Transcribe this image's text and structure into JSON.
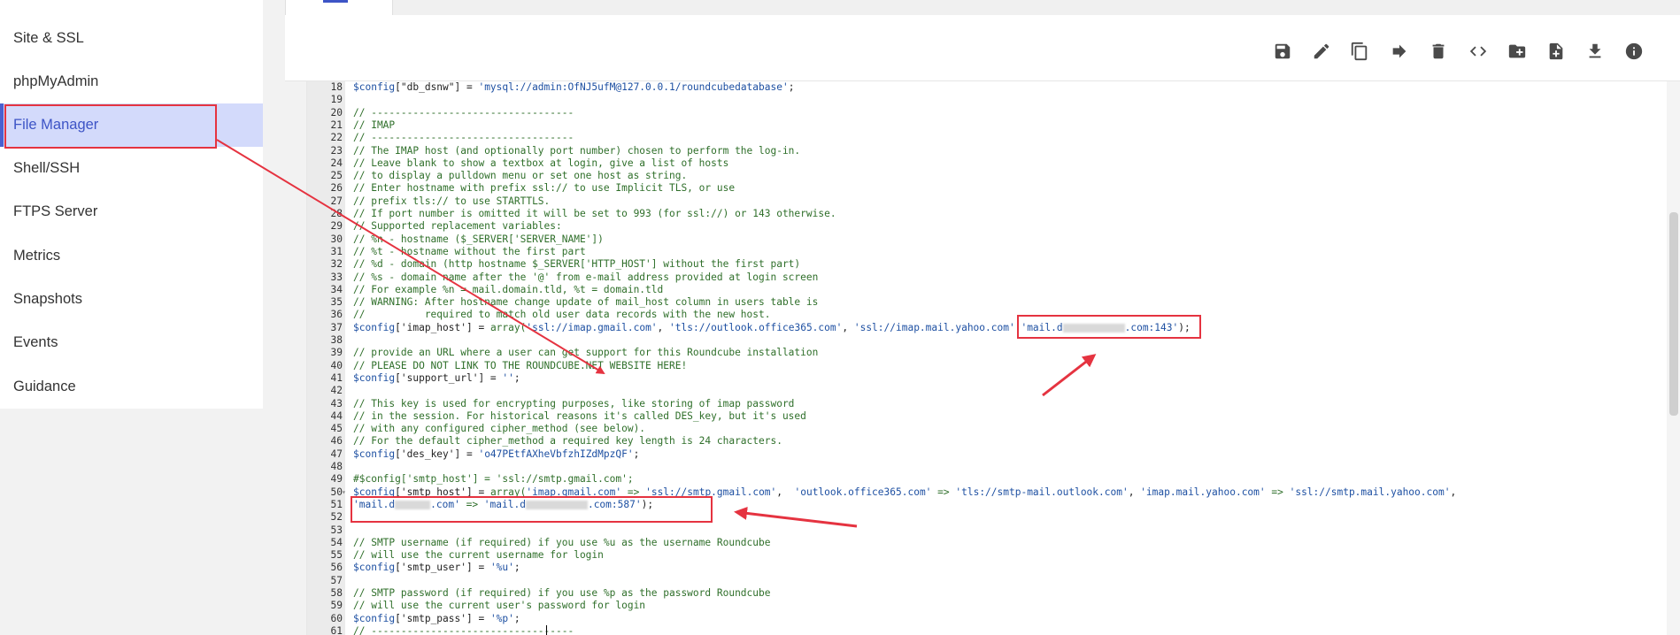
{
  "sidebar": {
    "items": [
      {
        "label": "Site & SSL",
        "active": false
      },
      {
        "label": "phpMyAdmin",
        "active": false
      },
      {
        "label": "File Manager",
        "active": true
      },
      {
        "label": "Shell/SSH",
        "active": false
      },
      {
        "label": "FTPS Server",
        "active": false
      },
      {
        "label": "Metrics",
        "active": false
      },
      {
        "label": "Snapshots",
        "active": false
      },
      {
        "label": "Events",
        "active": false
      },
      {
        "label": "Guidance",
        "active": false
      }
    ]
  },
  "toolbar": {
    "icons": [
      "save-icon",
      "edit-icon",
      "copy-icon",
      "move-icon",
      "delete-icon",
      "code-icon",
      "new-folder-icon",
      "new-file-icon",
      "download-icon",
      "info-icon"
    ]
  },
  "editor": {
    "lines": [
      {
        "n": "18",
        "segs": [
          [
            "var",
            "$config"
          ],
          [
            "",
            "[\"db_dsnw\"] = "
          ],
          [
            "str",
            "'mysql://admin:OfNJ5ufM@127.0.0.1/roundcubedatabase'"
          ],
          [
            "",
            ";"
          ]
        ]
      },
      {
        "n": "19",
        "segs": []
      },
      {
        "n": "20",
        "segs": [
          [
            "cmt",
            "// ----------------------------------"
          ]
        ]
      },
      {
        "n": "21",
        "segs": [
          [
            "cmt",
            "// IMAP"
          ]
        ]
      },
      {
        "n": "22",
        "segs": [
          [
            "cmt",
            "// ----------------------------------"
          ]
        ]
      },
      {
        "n": "23",
        "segs": [
          [
            "cmt",
            "// The IMAP host (and optionally port number) chosen to perform the log-in."
          ]
        ]
      },
      {
        "n": "24",
        "segs": [
          [
            "cmt",
            "// Leave blank to show a textbox at login, give a list of hosts"
          ]
        ]
      },
      {
        "n": "25",
        "segs": [
          [
            "cmt",
            "// to display a pulldown menu or set one host as string."
          ]
        ]
      },
      {
        "n": "26",
        "segs": [
          [
            "cmt",
            "// Enter hostname with prefix ssl:// to use Implicit TLS, or use"
          ]
        ]
      },
      {
        "n": "27",
        "segs": [
          [
            "cmt",
            "// prefix tls:// to use STARTTLS."
          ]
        ]
      },
      {
        "n": "28",
        "segs": [
          [
            "cmt",
            "// If port number is omitted it will be set to 993 (for ssl://) or 143 otherwise."
          ]
        ]
      },
      {
        "n": "29",
        "segs": [
          [
            "cmt",
            "// Supported replacement variables:"
          ]
        ]
      },
      {
        "n": "30",
        "segs": [
          [
            "cmt",
            "// %n - hostname ($_SERVER['SERVER_NAME'])"
          ]
        ]
      },
      {
        "n": "31",
        "segs": [
          [
            "cmt",
            "// %t - hostname without the first part"
          ]
        ]
      },
      {
        "n": "32",
        "segs": [
          [
            "cmt",
            "// %d - domain (http hostname $_SERVER['HTTP_HOST'] without the first part)"
          ]
        ]
      },
      {
        "n": "33",
        "segs": [
          [
            "cmt",
            "// %s - domain name after the '@' from e-mail address provided at login screen"
          ]
        ]
      },
      {
        "n": "34",
        "segs": [
          [
            "cmt",
            "// For example %n = mail.domain.tld, %t = domain.tld"
          ]
        ]
      },
      {
        "n": "35",
        "segs": [
          [
            "cmt",
            "// WARNING: After hostname change update of mail_host column in users table is"
          ]
        ]
      },
      {
        "n": "36",
        "segs": [
          [
            "cmt",
            "//          required to match old user data records with the new host."
          ]
        ]
      },
      {
        "n": "37",
        "segs": [
          [
            "var",
            "$config"
          ],
          [
            "",
            "['imap_host'] = "
          ],
          [
            "op",
            "array("
          ],
          [
            "str",
            "'ssl://imap.gmail.com'"
          ],
          [
            "",
            ", "
          ],
          [
            "str",
            "'tls://outlook.office365.com'"
          ],
          [
            "",
            ", "
          ],
          [
            "str",
            "'ssl://imap.mail.yahoo.com'"
          ],
          [
            "",
            ","
          ],
          [
            "str",
            "'mail.d"
          ],
          [
            "redact",
            ""
          ],
          [
            "str",
            ".com:143'"
          ],
          [
            "",
            ");"
          ]
        ]
      },
      {
        "n": "38",
        "segs": []
      },
      {
        "n": "39",
        "segs": [
          [
            "cmt",
            "// provide an URL where a user can get support for this Roundcube installation"
          ]
        ]
      },
      {
        "n": "40",
        "segs": [
          [
            "cmt",
            "// PLEASE DO NOT LINK TO THE ROUNDCUBE.NET WEBSITE HERE!"
          ]
        ]
      },
      {
        "n": "41",
        "segs": [
          [
            "var",
            "$config"
          ],
          [
            "",
            "['support_url'] = "
          ],
          [
            "str",
            "''"
          ],
          [
            "",
            ";"
          ]
        ]
      },
      {
        "n": "42",
        "segs": []
      },
      {
        "n": "43",
        "segs": [
          [
            "cmt",
            "// This key is used for encrypting purposes, like storing of imap password"
          ]
        ]
      },
      {
        "n": "44",
        "segs": [
          [
            "cmt",
            "// in the session. For historical reasons it's called DES_key, but it's used"
          ]
        ]
      },
      {
        "n": "45",
        "segs": [
          [
            "cmt",
            "// with any configured cipher_method (see below)."
          ]
        ]
      },
      {
        "n": "46",
        "segs": [
          [
            "cmt",
            "// For the default cipher_method a required key length is 24 characters."
          ]
        ]
      },
      {
        "n": "47",
        "segs": [
          [
            "var",
            "$config"
          ],
          [
            "",
            "['des_key'] = "
          ],
          [
            "str",
            "'o47PEtfAXheVbfzhIZdMpzQF'"
          ],
          [
            "",
            ";"
          ]
        ]
      },
      {
        "n": "48",
        "segs": []
      },
      {
        "n": "49",
        "segs": [
          [
            "cmt",
            "#$config['smtp_host'] = 'ssl://smtp.gmail.com';"
          ]
        ]
      },
      {
        "n": "50",
        "fold": true,
        "segs": [
          [
            "var",
            "$config"
          ],
          [
            "",
            "['smtp_host'] = "
          ],
          [
            "op",
            "array("
          ],
          [
            "str",
            "'imap.gmail.com'"
          ],
          [
            "op",
            " => "
          ],
          [
            "str",
            "'ssl://smtp.gmail.com'"
          ],
          [
            "",
            ",  "
          ],
          [
            "str",
            "'outlook.office365.com'"
          ],
          [
            "op",
            " => "
          ],
          [
            "str",
            "'tls://smtp-mail.outlook.com'"
          ],
          [
            "",
            ", "
          ],
          [
            "str",
            "'imap.mail.yahoo.com'"
          ],
          [
            "op",
            " => "
          ],
          [
            "str",
            "'ssl://smtp.mail.yahoo.com'"
          ],
          [
            "",
            ","
          ]
        ]
      },
      {
        "n": "51",
        "segs": [
          [
            "str",
            "'mail.d"
          ],
          [
            "redact-s",
            ""
          ],
          [
            "str",
            ".com'"
          ],
          [
            "op",
            " => "
          ],
          [
            "str",
            "'mail.d"
          ],
          [
            "redact",
            ""
          ],
          [
            "str",
            ".com:587'"
          ],
          [
            "",
            ");"
          ]
        ]
      },
      {
        "n": "52",
        "segs": []
      },
      {
        "n": "53",
        "segs": []
      },
      {
        "n": "54",
        "segs": [
          [
            "cmt",
            "// SMTP username (if required) if you use %u as the username Roundcube"
          ]
        ]
      },
      {
        "n": "55",
        "segs": [
          [
            "cmt",
            "// will use the current username for login"
          ]
        ]
      },
      {
        "n": "56",
        "segs": [
          [
            "var",
            "$config"
          ],
          [
            "",
            "['smtp_user'] = "
          ],
          [
            "str",
            "'%u'"
          ],
          [
            "",
            ";"
          ]
        ]
      },
      {
        "n": "57",
        "segs": []
      },
      {
        "n": "58",
        "segs": [
          [
            "cmt",
            "// SMTP password (if required) if you use %p as the password Roundcube"
          ]
        ]
      },
      {
        "n": "59",
        "segs": [
          [
            "cmt",
            "// will use the current user's password for login"
          ]
        ]
      },
      {
        "n": "60",
        "segs": [
          [
            "var",
            "$config"
          ],
          [
            "",
            "['smtp_pass'] = "
          ],
          [
            "str",
            "'%p'"
          ],
          [
            "",
            ";"
          ]
        ]
      },
      {
        "n": "61",
        "segs": [
          [
            "cmt",
            "// ----------------------------------"
          ]
        ]
      }
    ]
  }
}
